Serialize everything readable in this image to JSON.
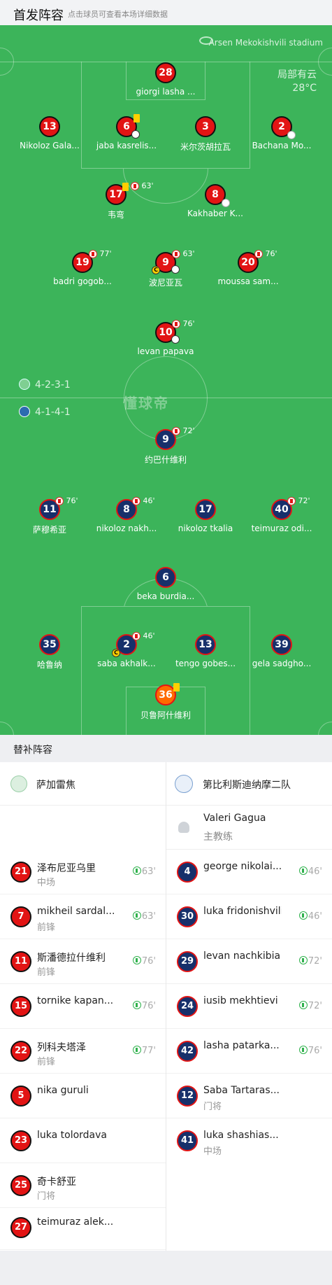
{
  "header": {
    "title": "首发阵容",
    "subtitle": "点击球员可查看本场详细数据"
  },
  "match": {
    "venue": "Arsen Mekokishvili stadium",
    "weather": "局部有云",
    "temperature": "28°C",
    "watermark": "懂球帝"
  },
  "home": {
    "formation": "4-2-3-1",
    "players": [
      {
        "num": "28",
        "name": "giorgi lasha ..."
      },
      {
        "num": "13",
        "name": "Nikoloz Gala..."
      },
      {
        "num": "6",
        "name": "jaba kasrelis..."
      },
      {
        "num": "3",
        "name": "米尔茨胡拉瓦"
      },
      {
        "num": "2",
        "name": "Bachana Mo..."
      },
      {
        "num": "17",
        "name": "韦弯",
        "sub_min": "63'"
      },
      {
        "num": "8",
        "name": "Kakhaber K..."
      },
      {
        "num": "19",
        "name": "badri gogob...",
        "sub_min": "77'"
      },
      {
        "num": "9",
        "name": "波尼亚瓦",
        "sub_min": "63'",
        "captain": "C"
      },
      {
        "num": "20",
        "name": "moussa sam...",
        "sub_min": "76'"
      },
      {
        "num": "10",
        "name": "levan papava",
        "sub_min": "76'"
      }
    ]
  },
  "away": {
    "formation": "4-1-4-1",
    "players": [
      {
        "num": "9",
        "name": "约巴什维利",
        "sub_min": "72'"
      },
      {
        "num": "11",
        "name": "萨穆希亚",
        "sub_min": "76'"
      },
      {
        "num": "8",
        "name": "nikoloz nakh...",
        "sub_min": "46'"
      },
      {
        "num": "17",
        "name": "nikoloz tkalia"
      },
      {
        "num": "40",
        "name": "teimuraz odi...",
        "sub_min": "72'"
      },
      {
        "num": "6",
        "name": "beka burdia..."
      },
      {
        "num": "35",
        "name": "哈鲁纳"
      },
      {
        "num": "2",
        "name": "saba akhalk...",
        "sub_min": "46'",
        "captain": "C"
      },
      {
        "num": "13",
        "name": "tengo gobes..."
      },
      {
        "num": "39",
        "name": "gela sadgho..."
      },
      {
        "num": "36",
        "name": "贝鲁阿什维利"
      }
    ]
  },
  "subs_section": {
    "title": "替补阵容"
  },
  "home_subs": {
    "team": "萨加雷焦",
    "players": [
      {
        "num": "21",
        "name": "泽布尼亚乌里",
        "pos": "中场",
        "min": "63'"
      },
      {
        "num": "7",
        "name": "mikheil sardal...",
        "pos": "前锋",
        "min": "63'"
      },
      {
        "num": "11",
        "name": "斯潘德拉什维利",
        "pos": "前锋",
        "min": "76'"
      },
      {
        "num": "15",
        "name": "tornike kapan...",
        "pos": "",
        "min": "76'"
      },
      {
        "num": "22",
        "name": "列科夫塔泽",
        "pos": "前锋",
        "min": "77'"
      },
      {
        "num": "5",
        "name": "nika guruli",
        "pos": "",
        "min": ""
      },
      {
        "num": "23",
        "name": "luka tolordava",
        "pos": "",
        "min": ""
      },
      {
        "num": "25",
        "name": "奇卡舒亚",
        "pos": "门将",
        "min": ""
      },
      {
        "num": "27",
        "name": "teimuraz alek...",
        "pos": "",
        "min": ""
      }
    ]
  },
  "away_subs": {
    "team": "第比利斯迪纳摩二队",
    "coach_name": "Valeri Gagua",
    "coach_role": "主教练",
    "players": [
      {
        "num": "4",
        "name": "george nikolai...",
        "pos": "",
        "min": "46'"
      },
      {
        "num": "30",
        "name": "luka fridonishvili",
        "pos": "",
        "min": "46'"
      },
      {
        "num": "29",
        "name": "levan nachkibia",
        "pos": "",
        "min": "72'"
      },
      {
        "num": "24",
        "name": "iusib mekhtievi",
        "pos": "",
        "min": "72'"
      },
      {
        "num": "42",
        "name": "lasha patarka...",
        "pos": "",
        "min": "76'"
      },
      {
        "num": "12",
        "name": "Saba Tartaras...",
        "pos": "门将",
        "min": ""
      },
      {
        "num": "41",
        "name": "luka shashias...",
        "pos": "中场",
        "min": ""
      }
    ]
  }
}
